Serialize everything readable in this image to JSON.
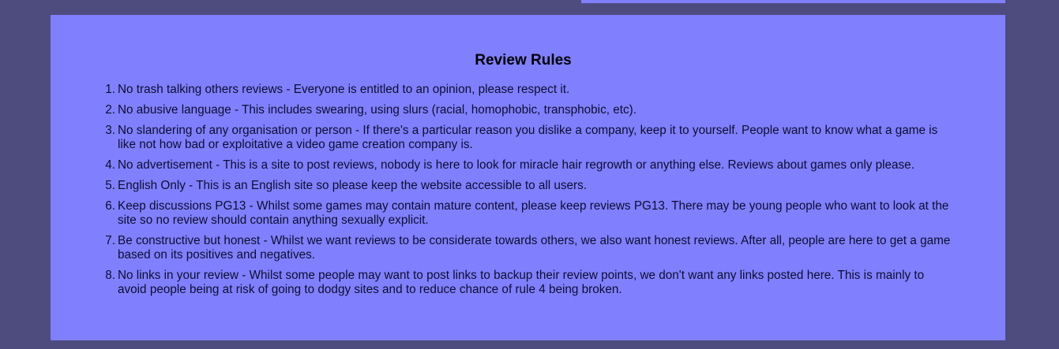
{
  "colors": {
    "page_background": "#4e4c7f",
    "panel_background": "#8080ff",
    "text": "#0d0d2e"
  },
  "review_rules": {
    "title": "Review Rules",
    "rules": [
      {
        "number": "1.",
        "text": "No trash talking others reviews - Everyone is entitled to an opinion, please respect it."
      },
      {
        "number": "2.",
        "text": "No abusive language - This includes swearing, using slurs (racial, homophobic, transphobic, etc)."
      },
      {
        "number": "3.",
        "text": "No slandering of any organisation or person - If there's a particular reason you dislike a company, keep it to yourself. People want to know what a game is like not how bad or exploitative a video game creation company is."
      },
      {
        "number": "4.",
        "text": "No advertisement - This is a site to post reviews, nobody is here to look for miracle hair regrowth or anything else. Reviews about games only please."
      },
      {
        "number": "5.",
        "text": "English Only - This is an English site so please keep the website accessible to all users."
      },
      {
        "number": "6.",
        "text": "Keep discussions PG13 - Whilst some games may contain mature content, please keep reviews PG13. There may be young people who want to look at the site so no review should contain anything sexually explicit."
      },
      {
        "number": "7.",
        "text": "Be constructive but honest - Whilst we want reviews to be considerate towards others, we also want honest reviews. After all, people are here to get a game based on its positives and negatives."
      },
      {
        "number": "8.",
        "text": "No links in your review - Whilst some people may want to post links to backup their review points, we don't want any links posted here. This is mainly to avoid people being at risk of going to dodgy sites and to reduce chance of rule 4 being broken."
      }
    ]
  }
}
